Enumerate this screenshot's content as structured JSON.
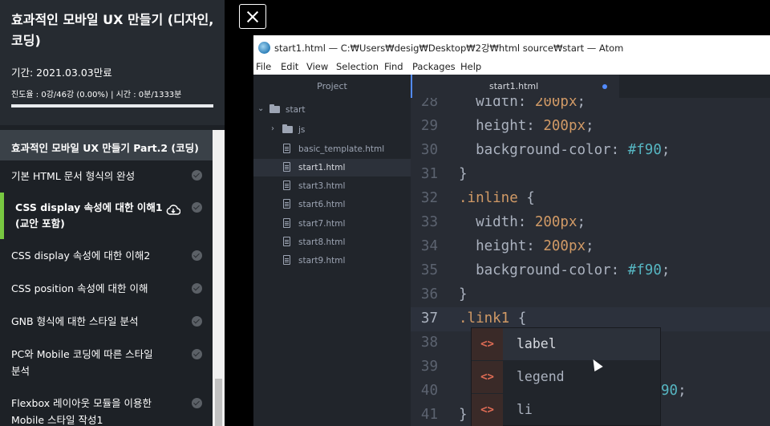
{
  "course": {
    "title": "효과적인 모바일 UX 만들기 (디자인, 코딩)",
    "period": "기간: 2021.03.03만료",
    "progress_text": "진도율 : 0강/46강 (0.00%) | 시간 : 0분/1333분",
    "progress_fraction": 0.0
  },
  "section": {
    "title": "효과적인 모바일 UX 만들기 Part.2 (코딩)"
  },
  "lessons": [
    {
      "label": "기본 HTML 문서 형식의 완성"
    },
    {
      "label": "CSS display 속성에 대한 이해1",
      "extra": "(교안 포함)",
      "icon": "cloud-download-icon"
    },
    {
      "label": "CSS display 속성에 대한 이해2"
    },
    {
      "label": "CSS position 속성에 대한 이해"
    },
    {
      "label": "GNB 형식에 대한 스타일 분석"
    },
    {
      "label": "PC와 Mobile 코딩에 따른 스타일",
      "extra": "분석"
    },
    {
      "label": "Flexbox 레이아웃 모듈을 이용한",
      "extra": "Mobile 스타일 작성1"
    }
  ],
  "atom": {
    "window_title": "start1.html — C:₩Users₩desig₩Desktop₩2강₩html source₩start — Atom",
    "menu": [
      "File",
      "Edit",
      "View",
      "Selection",
      "Find",
      "Packages",
      "Help"
    ],
    "tree_header": "Project",
    "tree": {
      "root": "start",
      "folder": "js",
      "files": [
        "basic_template.html",
        "start1.html",
        "start3.html",
        "start6.html",
        "start7.html",
        "start8.html",
        "start9.html"
      ],
      "selected": "start1.html"
    },
    "tab": {
      "label": "start1.html",
      "modified": true
    },
    "code_lines": [
      {
        "n": "28",
        "a": "  width: ",
        "b": "200px",
        "c": ";"
      },
      {
        "n": "29",
        "a": "  height: ",
        "b": "200px",
        "c": ";"
      },
      {
        "n": "30",
        "a": "  background-color: ",
        "h": "#f90",
        "c": ";"
      },
      {
        "n": "31",
        "a": "}"
      },
      {
        "n": "32",
        "a": ".inline {"
      },
      {
        "n": "33",
        "a": "  width: ",
        "b": "200px",
        "c": ";"
      },
      {
        "n": "34",
        "a": "  height: ",
        "b": "200px",
        "c": ";"
      },
      {
        "n": "35",
        "a": "  background-color: ",
        "h": "#f90",
        "c": ";"
      },
      {
        "n": "36",
        "a": "}"
      },
      {
        "n": "37",
        "a": ".link1 {"
      },
      {
        "n": "38",
        "a": ""
      },
      {
        "n": "39",
        "a": ""
      },
      {
        "n": "40",
        "a": "",
        "tail": "90;"
      },
      {
        "n": "41",
        "a": "}"
      }
    ],
    "autocomplete": [
      "label",
      "legend",
      "li"
    ],
    "autocomplete_badge": "<>"
  }
}
